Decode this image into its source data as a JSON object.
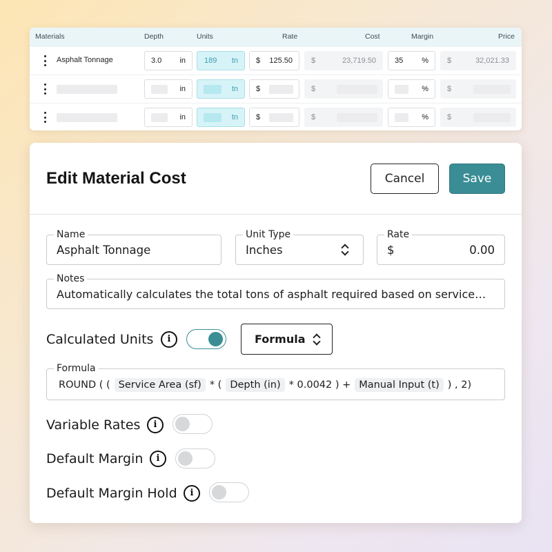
{
  "table": {
    "headers": {
      "materials": "Materials",
      "depth": "Depth",
      "units": "Units",
      "rate": "Rate",
      "cost": "Cost",
      "margin": "Margin",
      "price": "Price"
    },
    "rows": [
      {
        "name": "Asphalt Tonnage",
        "depth": "3.0",
        "depth_unit": "in",
        "units": "189",
        "units_unit": "tn",
        "rate_symbol": "$",
        "rate": "125.50",
        "cost_symbol": "$",
        "cost": "23,719.50",
        "margin": "35",
        "margin_unit": "%",
        "price_symbol": "$",
        "price": "32,021.33"
      },
      {
        "depth_unit": "in",
        "units_unit": "tn",
        "rate_symbol": "$",
        "cost_symbol": "$",
        "margin_unit": "%",
        "price_symbol": "$"
      },
      {
        "depth_unit": "in",
        "units_unit": "tn",
        "rate_symbol": "$",
        "cost_symbol": "$",
        "margin_unit": "%",
        "price_symbol": "$"
      }
    ]
  },
  "modal": {
    "title": "Edit Material Cost",
    "cancel_label": "Cancel",
    "save_label": "Save",
    "name": {
      "label": "Name",
      "value": "Asphalt Tonnage"
    },
    "unit_type": {
      "label": "Unit Type",
      "value": "Inches"
    },
    "rate": {
      "label": "Rate",
      "symbol": "$",
      "value": "0.00"
    },
    "notes": {
      "label": "Notes",
      "value": "Automatically calculates the total tons of asphalt required based on service…"
    },
    "calculated_units": {
      "label": "Calculated Units",
      "enabled": true,
      "mode": "Formula"
    },
    "formula": {
      "label": "Formula",
      "tokens": {
        "t1": "ROUND ( (",
        "c1": "Service Area (sf)",
        "t2": "* (",
        "c2": "Depth (in)",
        "t3": "* 0.0042 ) +",
        "c3": "Manual Input (t)",
        "t4": ") , 2)"
      }
    },
    "variable_rates": {
      "label": "Variable Rates",
      "enabled": false
    },
    "default_margin": {
      "label": "Default Margin",
      "enabled": false
    },
    "default_margin_hold": {
      "label": "Default Margin Hold",
      "enabled": false
    }
  },
  "colors": {
    "accent": "#3a8d95",
    "units_highlight": "#d6f3f7",
    "header_bg": "#eaf5f7"
  },
  "icons": {
    "row_menu": "kebab-icon",
    "info": "info-icon",
    "select_arrows": "chevron-up-down-icon"
  }
}
